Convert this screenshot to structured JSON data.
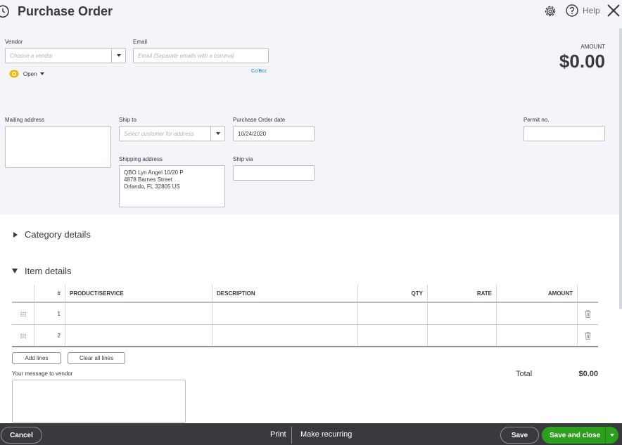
{
  "header": {
    "title": "Purchase Order",
    "help_label": "Help"
  },
  "vendor": {
    "label": "Vendor",
    "placeholder": "Choose a vendor",
    "status": "Open"
  },
  "email": {
    "label": "Email",
    "placeholder": "Email (Separate emails with a comma)",
    "cc_bcc": "Cc/Bcc"
  },
  "amount": {
    "label": "AMOUNT",
    "value": "$0.00"
  },
  "mailing_address": {
    "label": "Mailing address",
    "value": ""
  },
  "ship_to": {
    "label": "Ship to",
    "placeholder": "Select customer for address"
  },
  "shipping_address": {
    "label": "Shipping address",
    "line1": "QBO Lyn Angel 10/20 P",
    "line2": "4878  Barnes Street",
    "line3": "Orlando, FL  32805 US"
  },
  "po_date": {
    "label": "Purchase Order date",
    "value": "10/24/2020"
  },
  "ship_via": {
    "label": "Ship via",
    "value": ""
  },
  "permit": {
    "label": "Permit no.",
    "value": ""
  },
  "sections": {
    "category": "Category details",
    "item": "Item details"
  },
  "item_table": {
    "columns": [
      "#",
      "PRODUCT/SERVICE",
      "DESCRIPTION",
      "QTY",
      "RATE",
      "AMOUNT"
    ],
    "rows": [
      {
        "num": "1",
        "product": "",
        "description": "",
        "qty": "",
        "rate": "",
        "amount": ""
      },
      {
        "num": "2",
        "product": "",
        "description": "",
        "qty": "",
        "rate": "",
        "amount": ""
      }
    ]
  },
  "actions": {
    "add_lines": "Add lines",
    "clear_lines": "Clear all lines"
  },
  "message": {
    "label": "Your message to vendor",
    "value": ""
  },
  "total": {
    "label": "Total",
    "value": "$0.00"
  },
  "footer": {
    "cancel": "Cancel",
    "print": "Print",
    "make_recurring": "Make recurring",
    "save": "Save",
    "save_and_close": "Save and close"
  },
  "colors": {
    "primary_green": "#2ca01c",
    "footer_bg": "#393a3d",
    "form_bg": "#f4f5f8",
    "link_blue": "#0077c5",
    "status_yellow": "#f2b700"
  },
  "icons": {
    "history": "history-icon",
    "settings": "gear-icon",
    "help": "help-icon",
    "close": "close-icon",
    "status": "eye-icon",
    "drag": "drag-handle-icon",
    "delete": "trash-icon"
  }
}
